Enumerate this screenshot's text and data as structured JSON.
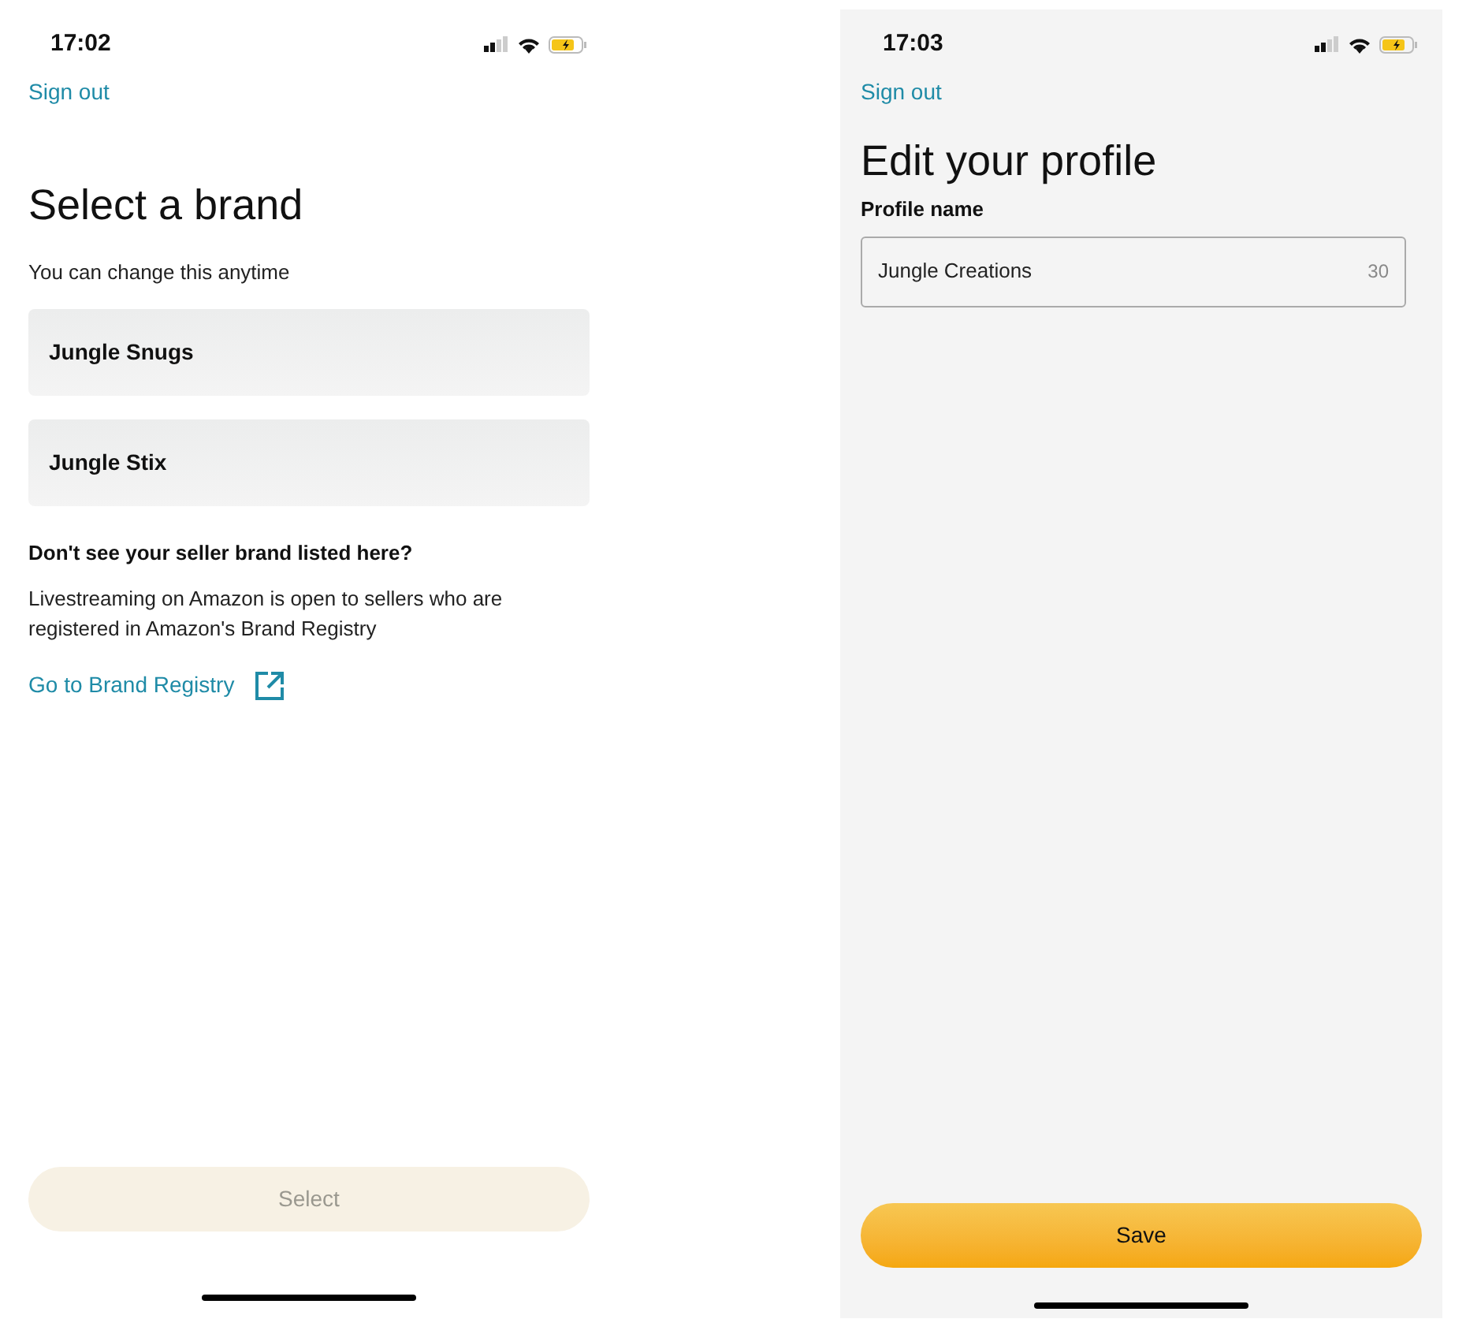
{
  "screens": [
    {
      "time": "17:02",
      "sign_out": "Sign out",
      "title": "Select a brand",
      "subtitle": "You can change this anytime",
      "brands": [
        {
          "label": "Jungle Snugs",
          "selected": false
        },
        {
          "label": "Jungle Stix",
          "selected": false
        }
      ],
      "question": "Don't see your seller brand listed here?",
      "info": "Livestreaming on Amazon is open to sellers who are registered in Amazon's Brand Registry",
      "link": "Go to Brand Registry",
      "button": {
        "label": "Select",
        "disabled": true
      }
    },
    {
      "time": "17:03",
      "sign_out": "Sign out",
      "title": "Edit your profile",
      "field_label": "Profile name",
      "field": {
        "value": "Jungle Creations",
        "counter": "30"
      },
      "button": {
        "label": "Save",
        "disabled": false
      }
    }
  ]
}
